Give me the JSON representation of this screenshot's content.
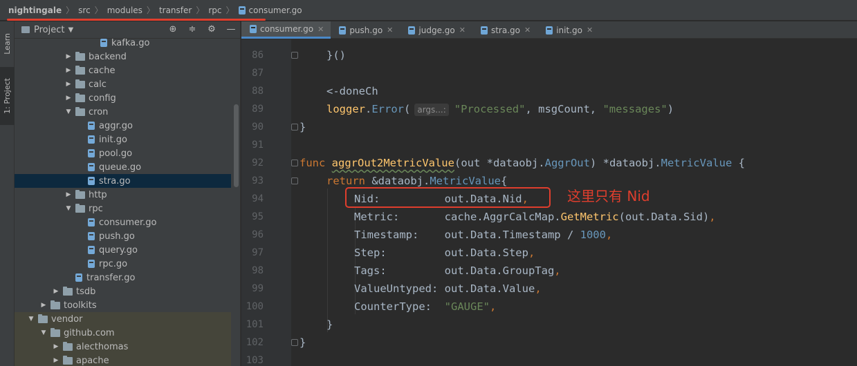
{
  "breadcrumb": {
    "items": [
      "nightingale",
      "src",
      "modules",
      "transfer",
      "rpc",
      "consumer.go"
    ]
  },
  "tool_strip": {
    "learn": "Learn",
    "project": "1: Project"
  },
  "project_panel": {
    "title": "Project",
    "tree": [
      {
        "label": "kafka.go",
        "kind": "file",
        "depth": 6,
        "arrow": ""
      },
      {
        "label": "backend",
        "kind": "folder",
        "depth": 4,
        "arrow": "▶"
      },
      {
        "label": "cache",
        "kind": "folder",
        "depth": 4,
        "arrow": "▶"
      },
      {
        "label": "calc",
        "kind": "folder",
        "depth": 4,
        "arrow": "▶"
      },
      {
        "label": "config",
        "kind": "folder",
        "depth": 4,
        "arrow": "▶"
      },
      {
        "label": "cron",
        "kind": "folder",
        "depth": 4,
        "arrow": "▼"
      },
      {
        "label": "aggr.go",
        "kind": "file",
        "depth": 5,
        "arrow": ""
      },
      {
        "label": "init.go",
        "kind": "file",
        "depth": 5,
        "arrow": ""
      },
      {
        "label": "pool.go",
        "kind": "file",
        "depth": 5,
        "arrow": ""
      },
      {
        "label": "queue.go",
        "kind": "file",
        "depth": 5,
        "arrow": ""
      },
      {
        "label": "stra.go",
        "kind": "file",
        "depth": 5,
        "arrow": "",
        "selected": true
      },
      {
        "label": "http",
        "kind": "folder",
        "depth": 4,
        "arrow": "▶"
      },
      {
        "label": "rpc",
        "kind": "folder",
        "depth": 4,
        "arrow": "▼"
      },
      {
        "label": "consumer.go",
        "kind": "file",
        "depth": 5,
        "arrow": ""
      },
      {
        "label": "push.go",
        "kind": "file",
        "depth": 5,
        "arrow": ""
      },
      {
        "label": "query.go",
        "kind": "file",
        "depth": 5,
        "arrow": ""
      },
      {
        "label": "rpc.go",
        "kind": "file",
        "depth": 5,
        "arrow": ""
      },
      {
        "label": "transfer.go",
        "kind": "file",
        "depth": 4,
        "arrow": ""
      },
      {
        "label": "tsdb",
        "kind": "folder",
        "depth": 3,
        "arrow": "▶"
      },
      {
        "label": "toolkits",
        "kind": "folder",
        "depth": 2,
        "arrow": "▶"
      },
      {
        "label": "vendor",
        "kind": "folder",
        "depth": 1,
        "arrow": "▼",
        "vendor": true
      },
      {
        "label": "github.com",
        "kind": "folder",
        "depth": 2,
        "arrow": "▼",
        "vendor": true
      },
      {
        "label": "alecthomas",
        "kind": "folder",
        "depth": 3,
        "arrow": "▶",
        "vendor": true
      },
      {
        "label": "apache",
        "kind": "folder",
        "depth": 3,
        "arrow": "▶",
        "vendor": true
      }
    ]
  },
  "editor_tabs": [
    {
      "label": "consumer.go",
      "active": true
    },
    {
      "label": "push.go",
      "active": false
    },
    {
      "label": "judge.go",
      "active": false
    },
    {
      "label": "stra.go",
      "active": false
    },
    {
      "label": "init.go",
      "active": false
    }
  ],
  "code": {
    "line_numbers": [
      "86",
      "87",
      "88",
      "89",
      "90",
      "91",
      "92",
      "93",
      "94",
      "95",
      "96",
      "97",
      "98",
      "99",
      "100",
      "101",
      "102",
      "103"
    ],
    "l86": "}()",
    "l88": "<-doneCh",
    "l89_recv": "logger",
    "l89_dot": ".",
    "l89_call": "Error",
    "l89_paren": "(",
    "l89_hint": "args...:",
    "l89_str1": "\"Processed\"",
    "l89_mid": ", msgCount, ",
    "l89_str2": "\"messages\"",
    "l89_end": ")",
    "l90": "}",
    "l92_kw": "func ",
    "l92_fn": "aggrOut2MetricValue",
    "l92_p1": "(out *dataobj.",
    "l92_t1": "AggrOut",
    "l92_p2": ") *dataobj.",
    "l92_t2": "MetricValue",
    "l92_p3": " {",
    "l93_kw": "return ",
    "l93_a": "&dataobj.",
    "l93_t": "MetricValue",
    "l93_b": "{",
    "l94_k": "Nid:          ",
    "l94_v": "out.Data.Nid",
    "l94_c": ",",
    "l95_k": "Metric:       ",
    "l95_a": "cache.AggrCalcMap.",
    "l95_call": "GetMetric",
    "l95_b": "(out.Data.Sid)",
    "l95_c": ",",
    "l96_k": "Timestamp:    ",
    "l96_a": "out.Data.Timestamp / ",
    "l96_n": "1000",
    "l96_c": ",",
    "l97_k": "Step:         ",
    "l97_a": "out.Data.Step",
    "l97_c": ",",
    "l98_k": "Tags:         ",
    "l98_a": "out.Data.GroupTag",
    "l98_c": ",",
    "l99_k": "ValueUntyped: ",
    "l99_a": "out.Data.Value",
    "l99_c": ",",
    "l100_k": "CounterType:  ",
    "l100_s": "\"GAUGE\"",
    "l100_c": ",",
    "l101": "}",
    "l102": "}"
  },
  "annotation": {
    "text": "这里只有 Nid",
    "color": "#e03e2d"
  }
}
